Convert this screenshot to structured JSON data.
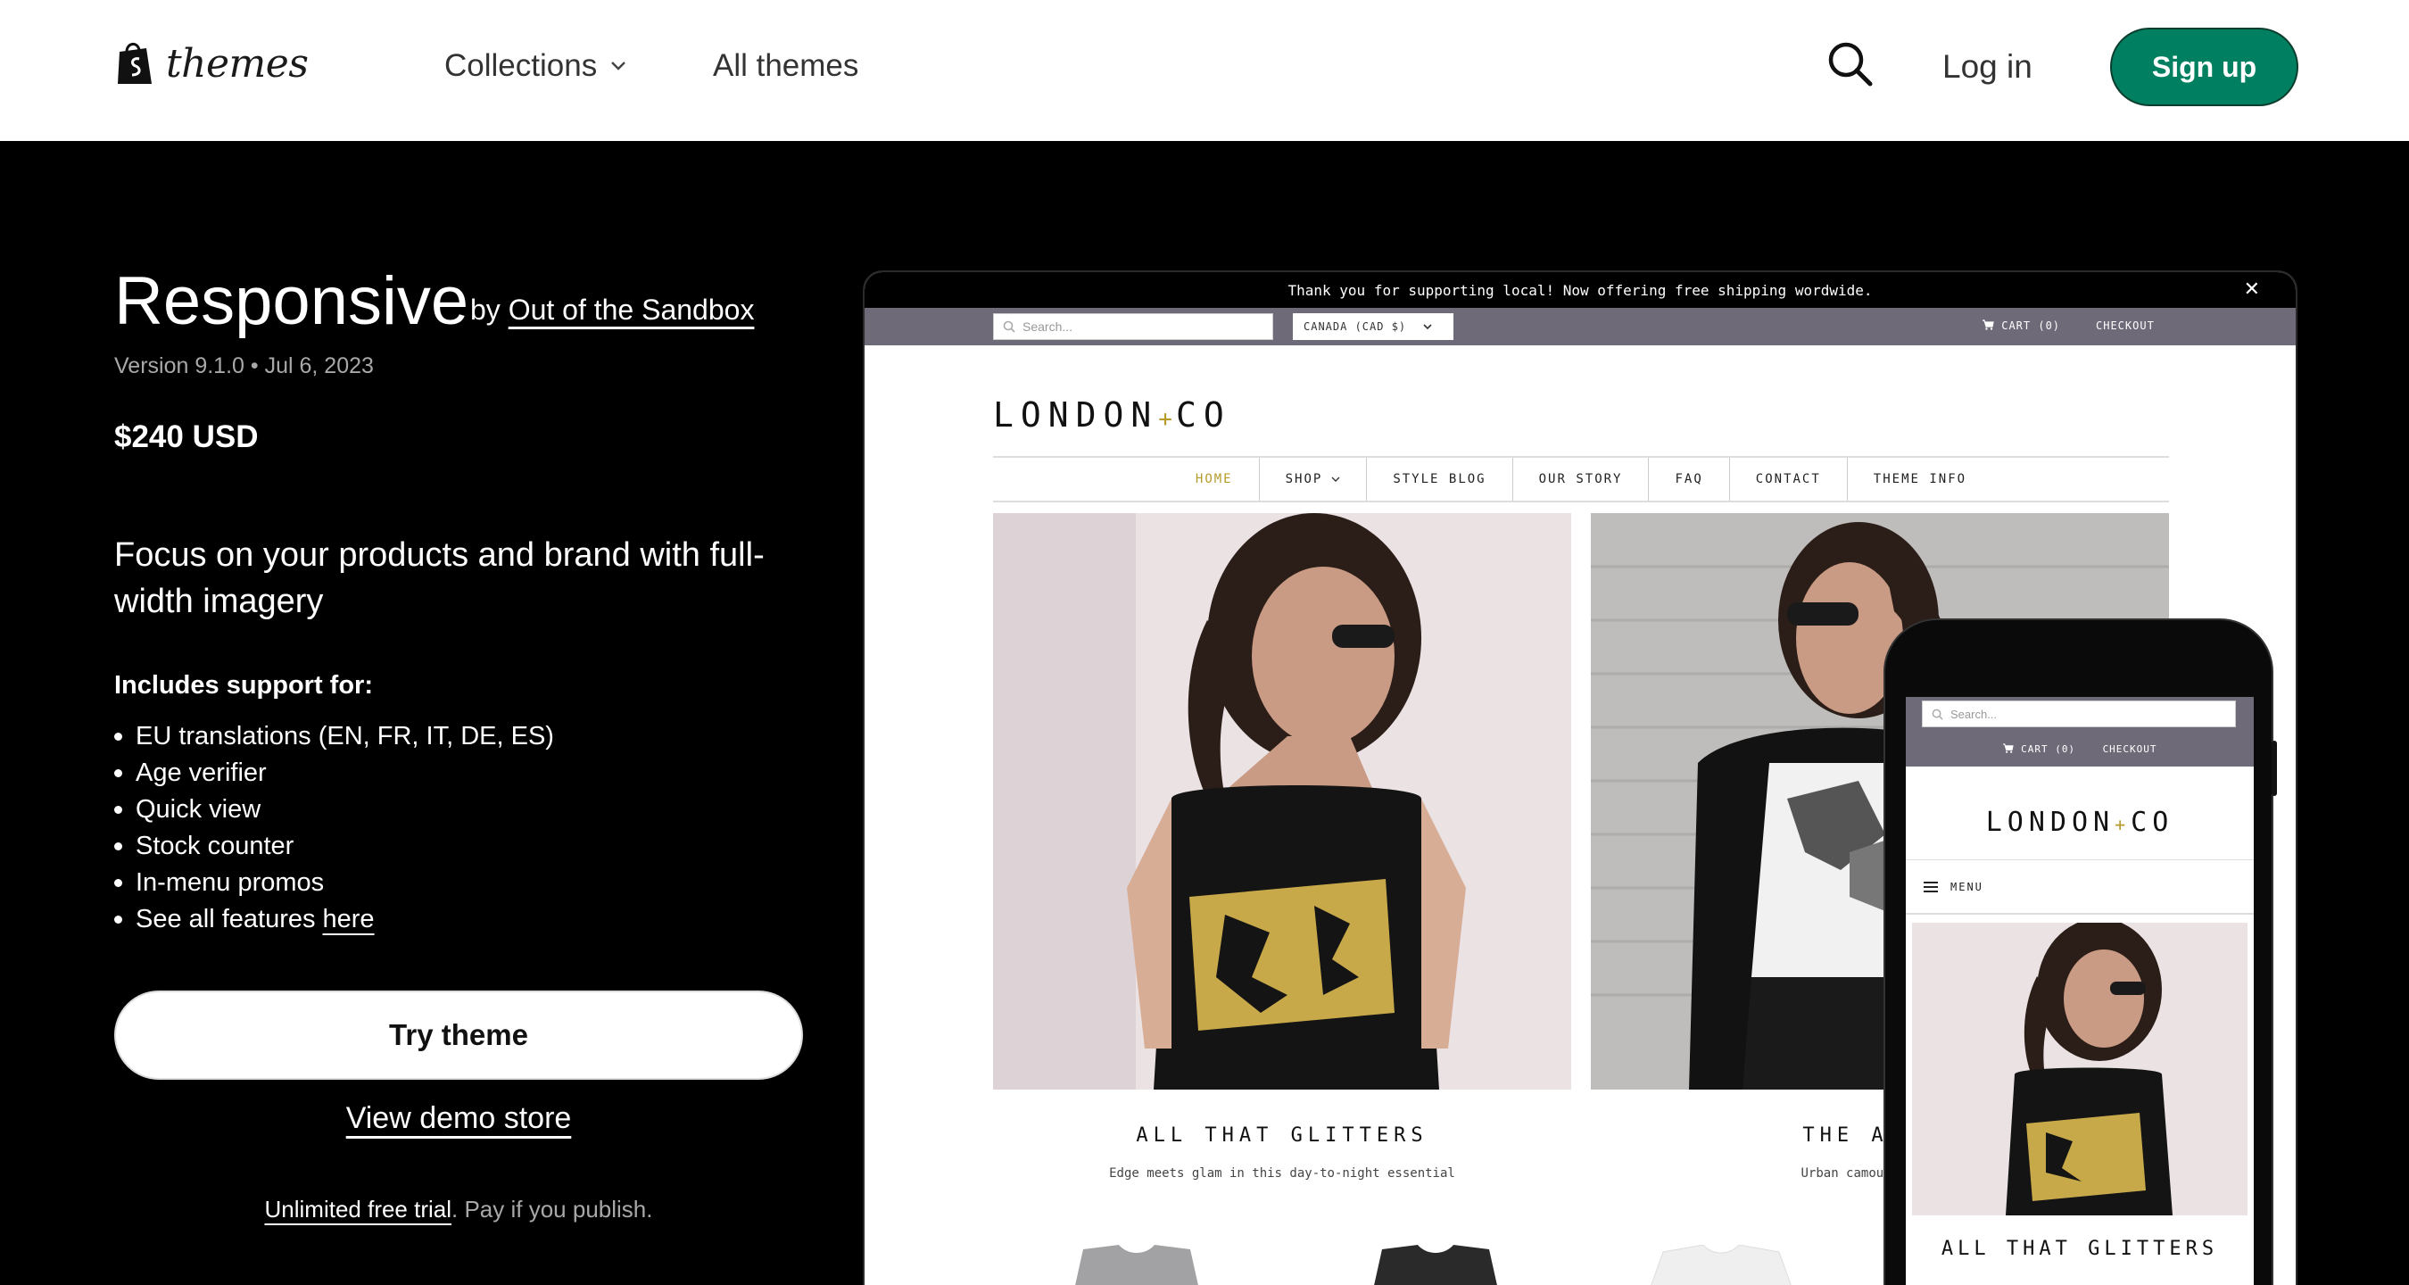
{
  "header": {
    "logo_text": "themes",
    "nav": [
      {
        "label": "Collections"
      },
      {
        "label": "All themes"
      }
    ],
    "login_label": "Log in",
    "signup_label": "Sign up",
    "signup_color": "#008060"
  },
  "theme": {
    "name": "Responsive",
    "by_prefix": "by",
    "author": "Out of the Sandbox",
    "version": "Version 9.1.0",
    "separator": "•",
    "date": "Jul 6, 2023",
    "price": "$240 USD",
    "tagline": "Focus on your products and brand with full-width imagery",
    "support_heading": "Includes support for:",
    "features": [
      "EU translations (EN, FR, IT, DE, ES)",
      "Age verifier",
      "Quick view",
      "Stock counter",
      "In-menu promos"
    ],
    "see_all_prefix": "See all features",
    "see_all_link": "here",
    "try_label": "Try theme",
    "demo_label": "View demo store",
    "trial_link": "Unlimited free trial",
    "trial_rest": ". Pay if you publish."
  },
  "preview": {
    "announcement": "Thank you for supporting local! Now offering free shipping wordwide.",
    "search_placeholder": "Search...",
    "currency": "CANADA (CAD $)",
    "cart": "CART (0)",
    "checkout": "CHECKOUT",
    "logo_left": "LONDON",
    "logo_plus": "+",
    "logo_right": "CO",
    "nav": [
      "HOME",
      "SHOP",
      "STYLE BLOG",
      "OUR STORY",
      "FAQ",
      "CONTACT",
      "THEME INFO"
    ],
    "hero1_title": "ALL THAT GLITTERS",
    "hero1_sub": "Edge meets glam in this day-to-night essential",
    "hero2_title": "THE ABSTR",
    "hero2_sub": "Urban camouflage that",
    "accent_color": "#b59b2c"
  },
  "phone": {
    "search_placeholder": "Search...",
    "cart": "CART (0)",
    "checkout": "CHECKOUT",
    "menu_label": "MENU",
    "hero_title": "ALL THAT GLITTERS"
  }
}
